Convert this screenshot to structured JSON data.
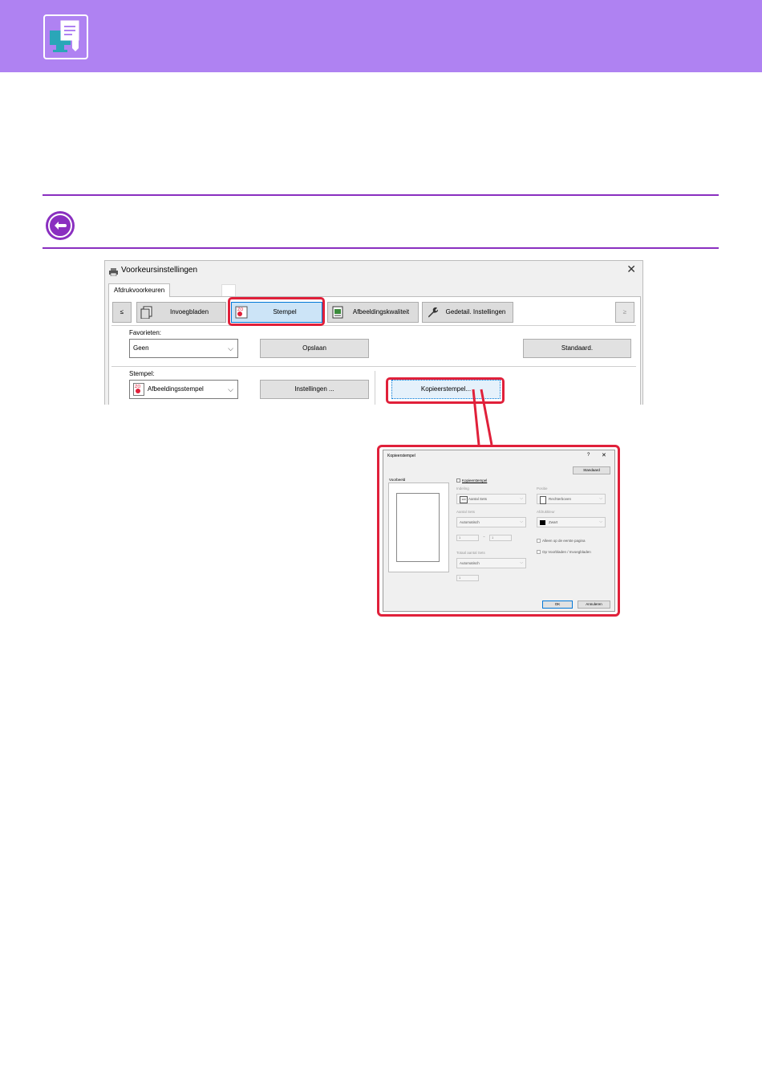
{
  "colors": {
    "header": "#af82f2",
    "rule": "#8a2fc0",
    "highlight": "#e0203a"
  },
  "header": {
    "icon": "printer-monitor-icon"
  },
  "note": {
    "icon": "back-arrow-icon"
  },
  "dialog": {
    "title": "Voorkeursinstellingen",
    "close": "✕",
    "tab": "Afdrukvoorkeuren",
    "nav_prev": "≤",
    "nav_next": "≥",
    "nav_buttons": [
      "Invoegbladen",
      "Stempel",
      "Afbeeldingskwaliteit",
      "Gedetail. Instellingen"
    ],
    "favorites_label": "Favorieten:",
    "favorites_value": "Geen",
    "save_button": "Opslaan",
    "default_button": "Standaard.",
    "stamp_label": "Stempel:",
    "stamp_value": "Afbeeldingsstempel",
    "settings_button": "Instellingen ...",
    "copy_stamp_button": "Kopieerstempel..."
  },
  "subdialog": {
    "title": "Kopieerstempel",
    "help": "?",
    "close": "✕",
    "default_button": "Standaard",
    "preview_label": "Voorbeeld",
    "checkbox_label": "Kopieerstempel",
    "layout_label": "Indeling",
    "layout_value": "Aantal Sets",
    "position_label": "Positie",
    "position_value": "Rechterboven",
    "sets_label": "Aantal Sets",
    "sets_value": "Automatisch",
    "color_label": "Afdrukkleur",
    "color_value": "Zwart",
    "field_a": "1",
    "field_sep": "~",
    "field_b": "1",
    "first_page_only": "Alleen op de eerste pagina",
    "on_covers": "Op Voorbladen / Invoegbladen",
    "total_label": "Totaal aantal Sets",
    "total_value": "Automatisch",
    "total_field": "1",
    "ok": "OK",
    "cancel": "Annuleren"
  }
}
